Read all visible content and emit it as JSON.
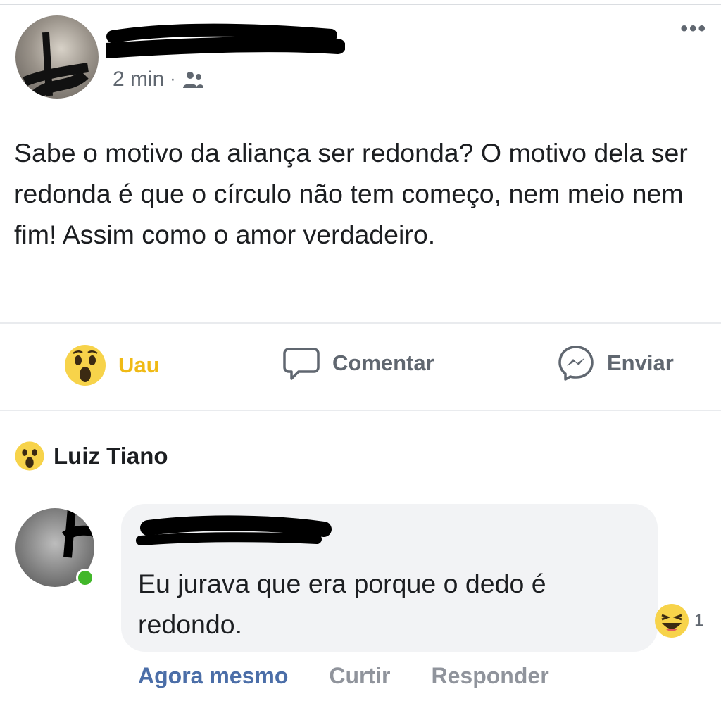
{
  "post": {
    "author_name": "",
    "timestamp": "2 min",
    "separator": "·",
    "privacy_icon": "friends-icon",
    "more_label": "•••",
    "text": "Sabe o motivo da aliança ser redonda? O motivo dela ser redonda é que o círculo não tem começo, nem meio nem fim! Assim como o amor verdadeiro."
  },
  "actions": {
    "reaction": {
      "label": "Uau",
      "icon": "wow-emoji-icon",
      "color": "#f0ba15"
    },
    "comment": {
      "label": "Comentar",
      "icon": "comment-bubble-icon"
    },
    "send": {
      "label": "Enviar",
      "icon": "messenger-icon"
    }
  },
  "reaction_summary": {
    "icon": "wow-emoji-icon",
    "name": "Luiz Tiano"
  },
  "comment": {
    "author_name": "",
    "online": true,
    "text": "Eu jurava que era porque o dedo é redondo.",
    "reaction_icon": "haha-emoji-icon",
    "reaction_count": "1",
    "timestamp": "Agora mesmo",
    "like_label": "Curtir",
    "reply_label": "Responder"
  },
  "colors": {
    "link_blue": "#4b6ea8",
    "secondary_text": "#606770",
    "online_green": "#42b72a",
    "bubble_bg": "#f2f3f5"
  }
}
